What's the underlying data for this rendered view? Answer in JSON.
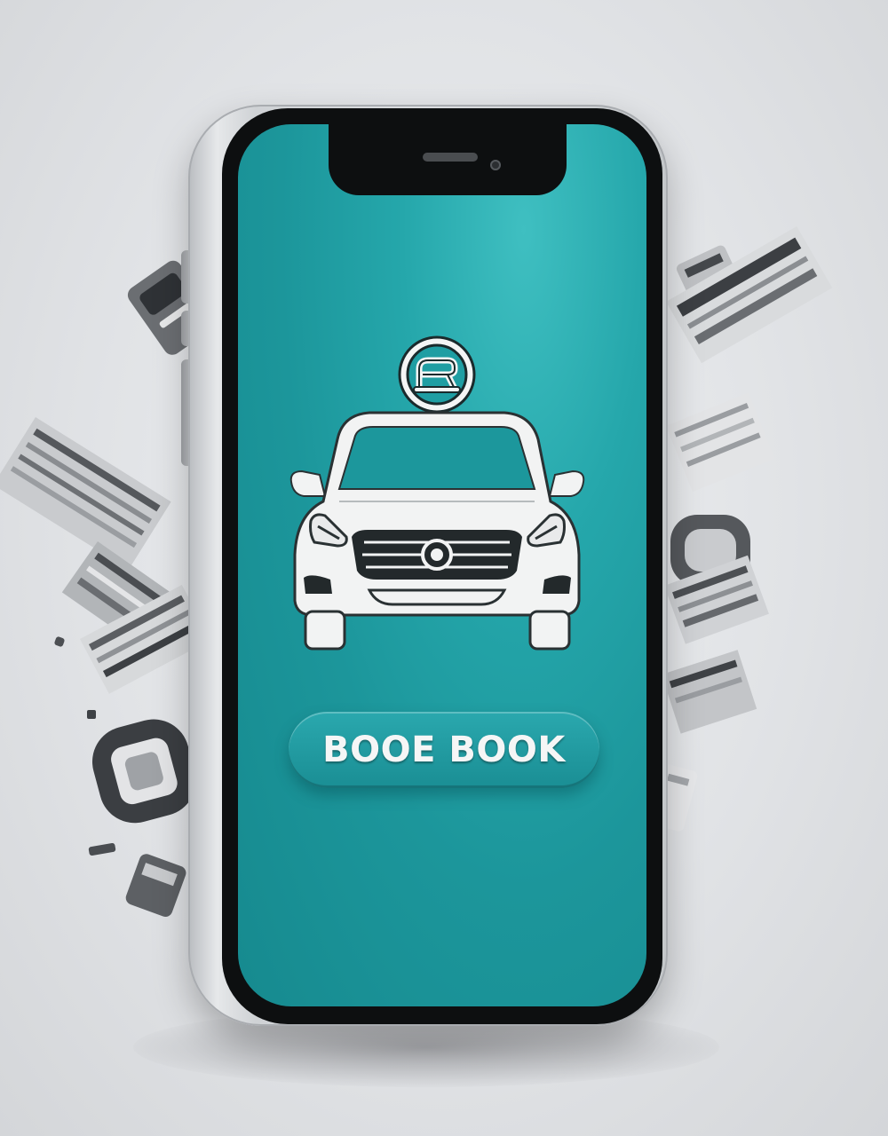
{
  "phone": {
    "screen_color": "#1f9ea3",
    "frame_color": "#d2d4d7",
    "bezel_color": "#0d0f10"
  },
  "app": {
    "logo_icon": "booking-logo-icon",
    "hero_icon": "car-front-icon",
    "book_button_label": "BOOE BOOK",
    "accent_color": "#1f9ea3",
    "text_color": "#f5f6f6"
  },
  "decorations": {
    "debris_icon": "paper-fragment-icon"
  }
}
